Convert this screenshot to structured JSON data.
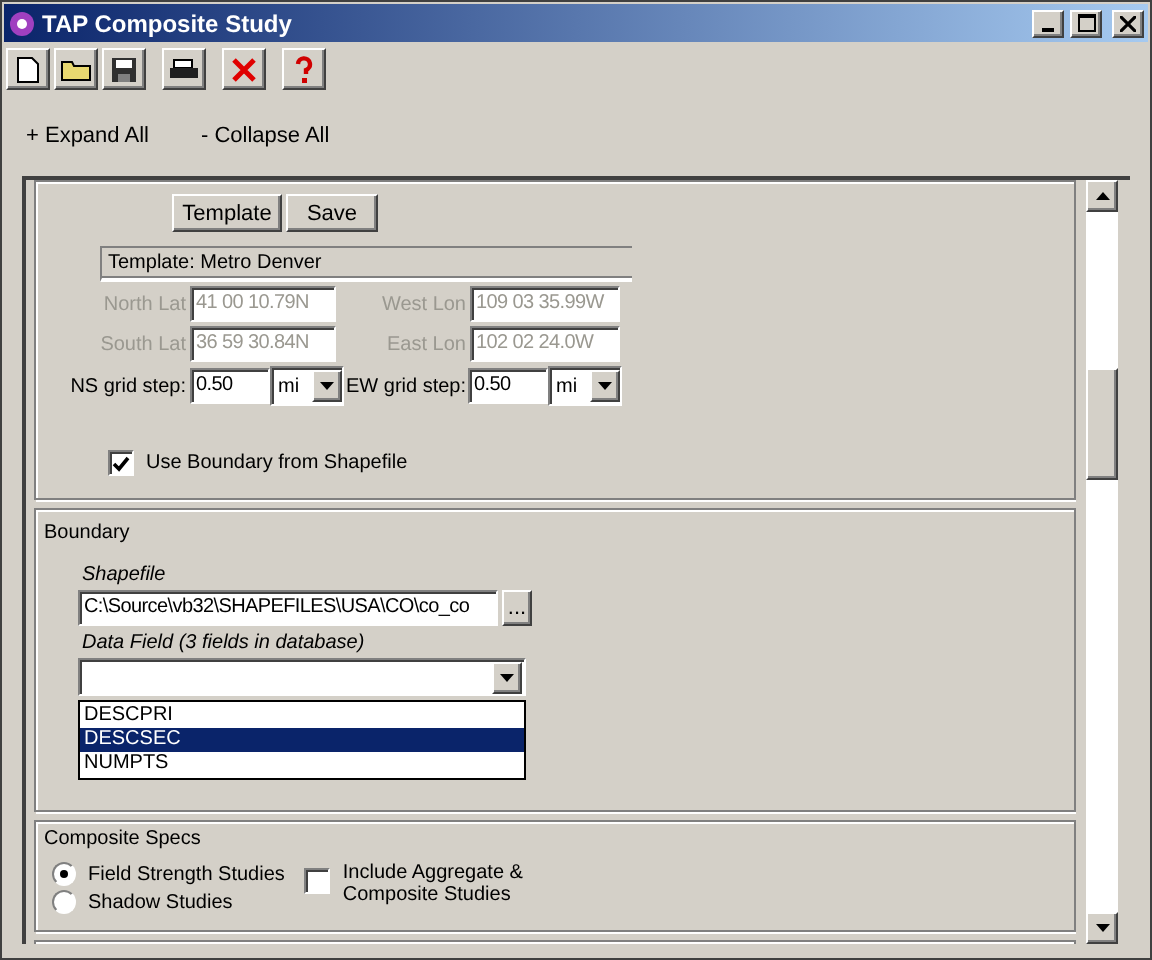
{
  "window": {
    "title": "TAP Composite Study"
  },
  "outline_links": [
    "+ Expand All",
    "- Collapse All"
  ],
  "template_section": {
    "buttons": [
      "Template",
      "Save"
    ],
    "template_label": "Template: Metro Denver",
    "coords": [
      {
        "label": "North Lat",
        "value": "41 00 10.79N",
        "disabled": true
      },
      {
        "label": "West Lon",
        "value": "109 03 35.99W",
        "disabled": true
      },
      {
        "label": "South Lat",
        "value": "36 59 30.84N",
        "disabled": true
      },
      {
        "label": "East Lon",
        "value": "102 02 24.0W",
        "disabled": true
      }
    ],
    "grid_steps": [
      {
        "label": "NS grid step:",
        "value": "0.50",
        "unit": "mi"
      },
      {
        "label": "EW grid step:",
        "value": "0.50",
        "unit": "mi"
      }
    ],
    "use_boundary": {
      "label": "Use Boundary from Shapefile",
      "checked": true
    }
  },
  "boundary": {
    "title": "Boundary",
    "shapefile_label": "Shapefile",
    "shapefile_value": "C:\\Source\\vb32\\SHAPEFILES\\USA\\CO\\co_co",
    "browse": "...",
    "data_field_label": "Data Field (3 fields in database)",
    "options": [
      {
        "label": "DESCPRI",
        "selected": false
      },
      {
        "label": "DESCSEC",
        "selected": true
      },
      {
        "label": "NUMPTS",
        "selected": false
      }
    ]
  },
  "composite_specs": {
    "title": "Composite Specs",
    "study_types": [
      {
        "label": "Field Strength Studies",
        "selected": true
      },
      {
        "label": "Shadow Studies",
        "selected": false
      }
    ],
    "include": {
      "label": "Include Aggregate & Composite Studies",
      "checked": false
    }
  }
}
